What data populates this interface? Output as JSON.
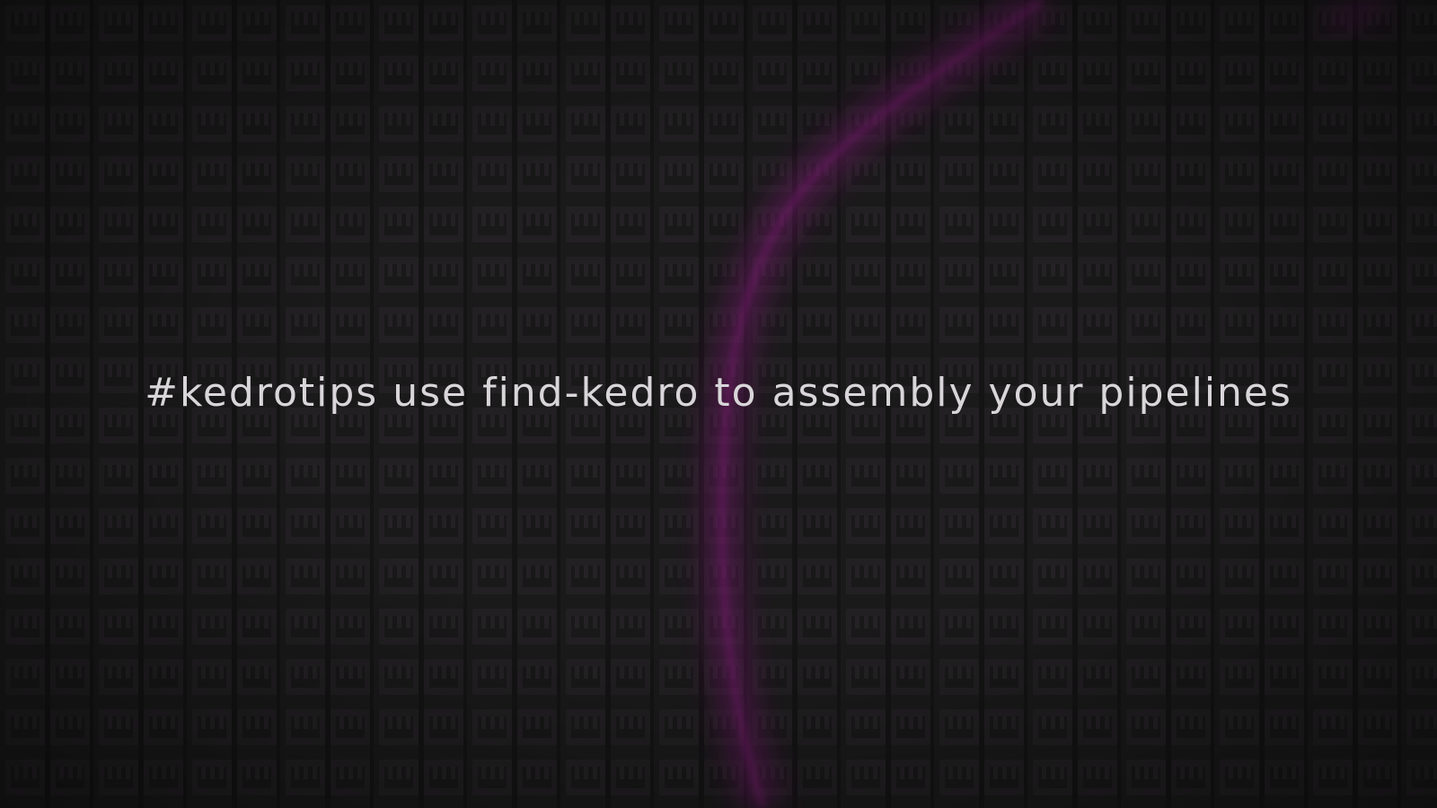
{
  "slide": {
    "headline": "#kedrotips use find-kedro to assembly your pipelines"
  },
  "background": {
    "base_color": "#1b1a1b",
    "tile_color": "#232123",
    "tile_edge_color": "#141314",
    "accent_color": "#7a1a6e"
  }
}
